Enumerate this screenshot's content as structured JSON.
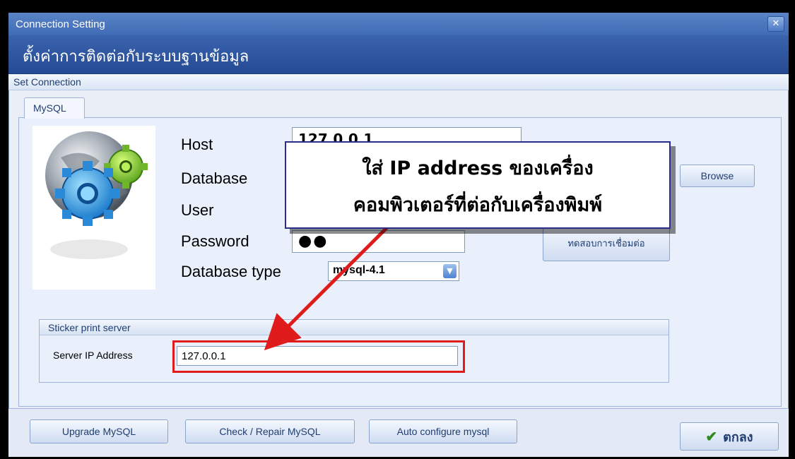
{
  "window": {
    "title": "Connection Setting",
    "close_label": "✕"
  },
  "banner": {
    "title": "ตั้งค่าการติดต่อกับระบบฐานข้อมูล"
  },
  "section": {
    "title": "Set Connection"
  },
  "tabs": [
    {
      "label": "MySQL"
    }
  ],
  "form": {
    "host_label": "Host",
    "host_value": "127.0.0.1",
    "database_label": "Database",
    "user_label": "User",
    "password_label": "Password",
    "password_value": "●●",
    "dbtype_label": "Database type",
    "dbtype_value": "mysql-4.1"
  },
  "buttons": {
    "browse": "Browse",
    "test_connection": "ทดสอบการเชื่อมต่อ",
    "upgrade": "Upgrade MySQL",
    "check_repair": "Check / Repair MySQL",
    "auto_configure": "Auto configure mysql",
    "ok": "ตกลง",
    "ok_icon": "✔"
  },
  "sticker_group": {
    "title": "Sticker print server",
    "server_label": "Server IP Address",
    "server_value": "127.0.0.1"
  },
  "callout": {
    "line1": "ใส่  IP address ของเครื่อง",
    "line2": "คอมพิวเตอร์ที่ต่อกับเครื่องพิมพ์"
  },
  "colors": {
    "annotation_red": "#e01b1b",
    "banner_blue": "#2f56a0",
    "callout_border": "#2a2e8a"
  }
}
